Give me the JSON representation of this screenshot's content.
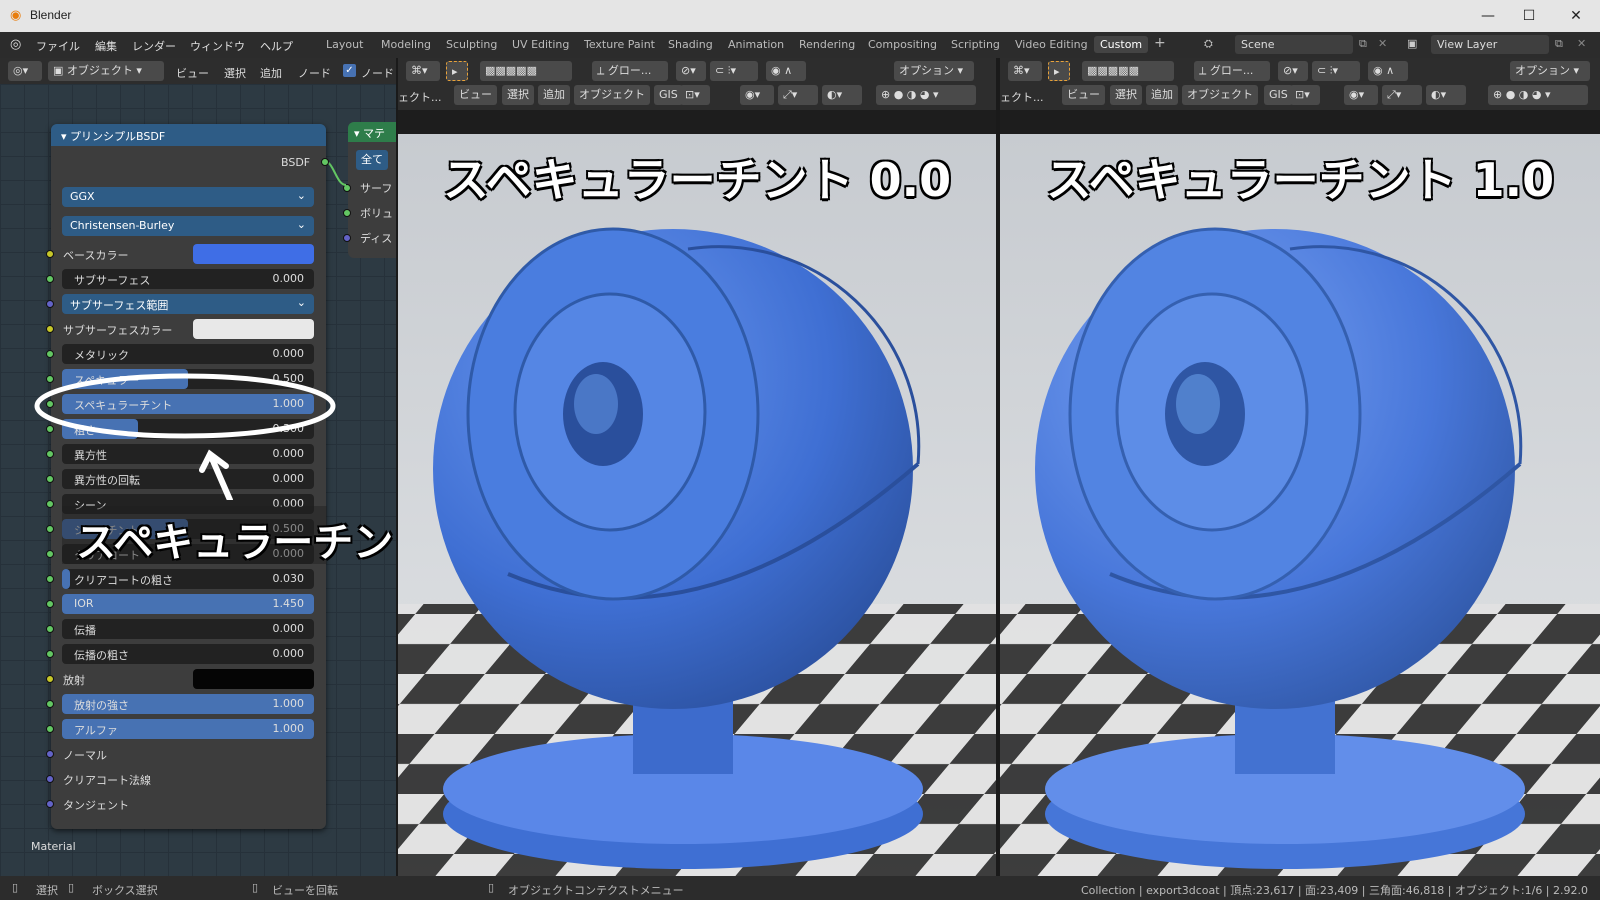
{
  "window": {
    "title": "Blender"
  },
  "menu": [
    "ファイル",
    "編集",
    "レンダー",
    "ウィンドウ",
    "ヘルプ"
  ],
  "workspaces": [
    "Layout",
    "Modeling",
    "Sculpting",
    "UV Editing",
    "Texture Paint",
    "Shading",
    "Animation",
    "Rendering",
    "Compositing",
    "Scripting",
    "Video Editing",
    "Custom"
  ],
  "active_workspace": "Custom",
  "scene": {
    "name": "Scene",
    "view_layer": "View Layer"
  },
  "node_header": {
    "mode": "オブジェクト",
    "view": "ビュー",
    "select": "選択",
    "add": "追加",
    "node": "ノード"
  },
  "viewport_header": {
    "orient": "グロー...",
    "options": "オプション",
    "menu_obj": "ェクト...",
    "view": "ビュー",
    "select": "選択",
    "add": "追加",
    "object": "オブジェクト",
    "gis": "GIS"
  },
  "node": {
    "title": "プリンシプルBSDF",
    "output": "BSDF",
    "distribution": "GGX",
    "subsurface_method": "Christensen-Burley",
    "rows": [
      {
        "label": "ベースカラー",
        "type": "color",
        "color": "#3f6ee6",
        "socket": "y"
      },
      {
        "label": "サブサーフェス",
        "value": "0.000",
        "type": "num",
        "socket": "g"
      },
      {
        "label": "サブサーフェス範囲",
        "type": "dropdown",
        "socket": "p"
      },
      {
        "label": "サブサーフェスカラー",
        "type": "color",
        "color": "#e8e8e8",
        "socket": "y"
      },
      {
        "label": "メタリック",
        "value": "0.000",
        "type": "num",
        "socket": "g"
      },
      {
        "label": "スペキュラー",
        "value": "0.500",
        "type": "num",
        "fill": 0.5,
        "socket": "g"
      },
      {
        "label": "スペキュラーチント",
        "value": "1.000",
        "type": "num",
        "fill": 1.0,
        "socket": "g"
      },
      {
        "label": "粗さ",
        "value": "0.300",
        "type": "num",
        "fill": 0.3,
        "socket": "g"
      },
      {
        "label": "異方性",
        "value": "0.000",
        "type": "num",
        "socket": "g"
      },
      {
        "label": "異方性の回転",
        "value": "0.000",
        "type": "num",
        "socket": "g"
      },
      {
        "label": "シーン",
        "value": "0.000",
        "type": "num",
        "socket": "g"
      },
      {
        "label": "シーンチント",
        "value": "0.500",
        "type": "num",
        "fill": 0.5,
        "socket": "g"
      },
      {
        "label": "クリアコート",
        "value": "0.000",
        "type": "num",
        "socket": "g"
      },
      {
        "label": "クリアコートの粗さ",
        "value": "0.030",
        "type": "num",
        "fill": 0.03,
        "socket": "g"
      },
      {
        "label": "IOR",
        "value": "1.450",
        "type": "num",
        "fill": 1.0,
        "socket": "g"
      },
      {
        "label": "伝播",
        "value": "0.000",
        "type": "num",
        "socket": "g"
      },
      {
        "label": "伝播の粗さ",
        "value": "0.000",
        "type": "num",
        "socket": "g"
      },
      {
        "label": "放射",
        "type": "color",
        "color": "#050505",
        "socket": "y"
      },
      {
        "label": "放射の強さ",
        "value": "1.000",
        "type": "num",
        "fill": 1.0,
        "socket": "g"
      },
      {
        "label": "アルファ",
        "value": "1.000",
        "type": "num",
        "fill": 1.0,
        "socket": "g"
      },
      {
        "label": "ノーマル",
        "type": "plain",
        "socket": "p"
      },
      {
        "label": "クリアコート法線",
        "type": "plain",
        "socket": "p"
      },
      {
        "label": "タンジェント",
        "type": "plain",
        "socket": "p"
      }
    ]
  },
  "output_node": {
    "title": "マテ",
    "button": "全て",
    "inputs": [
      "サーフ",
      "ボリュ",
      "ディス"
    ]
  },
  "material_label": "Material",
  "annotation": "スペキュラーチント",
  "viewport_left": {
    "title": "スペキュラーチント 0.0"
  },
  "viewport_right": {
    "title": "スペキュラーチント 1.0"
  },
  "status": {
    "select": "選択",
    "box_select": "ボックス選択",
    "rotate": "ビューを回転",
    "context_menu": "オブジェクトコンテクストメニュー",
    "info": "Collection | export3dcoat | 頂点:23,617 | 面:23,409 | 三角面:46,818 | オブジェクト:1/6 | 2.92.0"
  }
}
